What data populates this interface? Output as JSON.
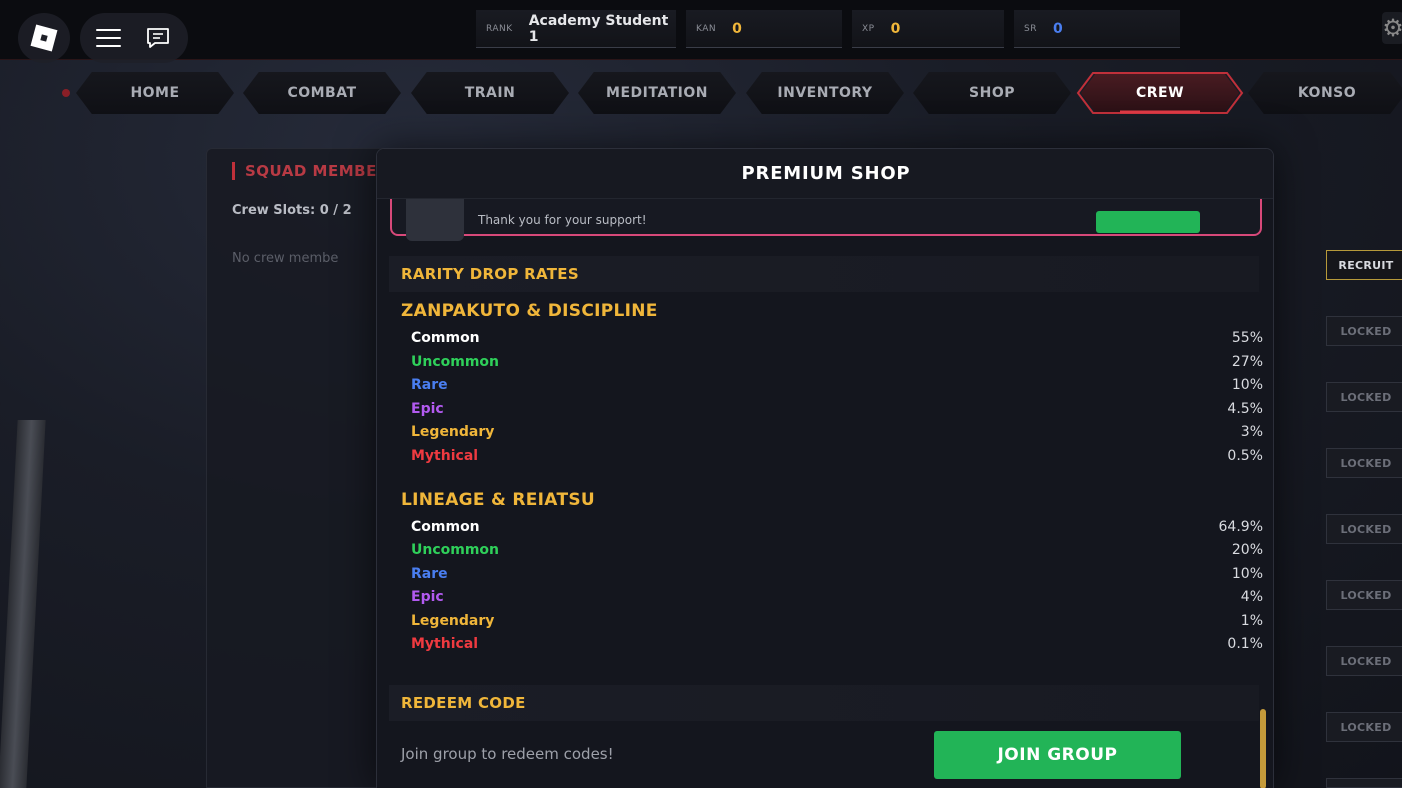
{
  "topbar": {
    "rank_label": "RANK",
    "rank_value": "Academy Student 1",
    "kan_label": "KAN",
    "kan_value": "0",
    "xp_label": "XP",
    "xp_value": "0",
    "sr_label": "SR",
    "sr_value": "0",
    "colors": {
      "kan": "#f0b63a",
      "xp": "#f0b63a",
      "sr": "#4a7ef0"
    }
  },
  "nav": {
    "tabs": [
      {
        "label": "HOME"
      },
      {
        "label": "COMBAT"
      },
      {
        "label": "TRAIN"
      },
      {
        "label": "MEDITATION"
      },
      {
        "label": "INVENTORY"
      },
      {
        "label": "SHOP"
      },
      {
        "label": "CREW",
        "active": true
      },
      {
        "label": "KONSO"
      }
    ]
  },
  "crew": {
    "title": "SQUAD MEMBE",
    "slots": "Crew Slots: 0 / 2",
    "empty": "No crew membe"
  },
  "side": {
    "recruit_label": "RECRUIT",
    "locked_label": "LOCKED"
  },
  "modal": {
    "title": "PREMIUM SHOP",
    "support_text": "Thank you for your support!",
    "rarity_header": "RARITY DROP RATES",
    "categories": [
      {
        "title": "ZANPAKUTO & DISCIPLINE",
        "rates": [
          {
            "name": "Common",
            "pct": "55%"
          },
          {
            "name": "Uncommon",
            "pct": "27%"
          },
          {
            "name": "Rare",
            "pct": "10%"
          },
          {
            "name": "Epic",
            "pct": "4.5%"
          },
          {
            "name": "Legendary",
            "pct": "3%"
          },
          {
            "name": "Mythical",
            "pct": "0.5%"
          }
        ]
      },
      {
        "title": "LINEAGE & REIATSU",
        "rates": [
          {
            "name": "Common",
            "pct": "64.9%"
          },
          {
            "name": "Uncommon",
            "pct": "20%"
          },
          {
            "name": "Rare",
            "pct": "10%"
          },
          {
            "name": "Epic",
            "pct": "4%"
          },
          {
            "name": "Legendary",
            "pct": "1%"
          },
          {
            "name": "Mythical",
            "pct": "0.1%"
          }
        ]
      }
    ],
    "redeem_header": "REDEEM CODE",
    "redeem_text": "Join group to redeem codes!",
    "join_label": "JOIN GROUP"
  }
}
